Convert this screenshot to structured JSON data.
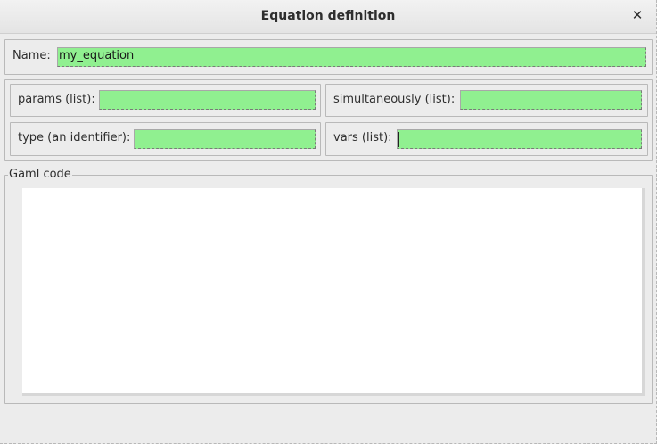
{
  "window": {
    "title": "Equation definition",
    "close_glyph": "✕"
  },
  "name_field": {
    "label": "Name:",
    "value": "my_equation"
  },
  "fields": {
    "params": {
      "label": "params (list):",
      "value": ""
    },
    "simultaneously": {
      "label": "simultaneously (list):",
      "value": ""
    },
    "type": {
      "label": "type (an identifier):",
      "value": ""
    },
    "vars": {
      "label": "vars (list):",
      "value": ""
    }
  },
  "gaml": {
    "legend": "Gaml code",
    "code": ""
  },
  "colors": {
    "field_background": "#90f090",
    "window_background": "#ececec"
  }
}
